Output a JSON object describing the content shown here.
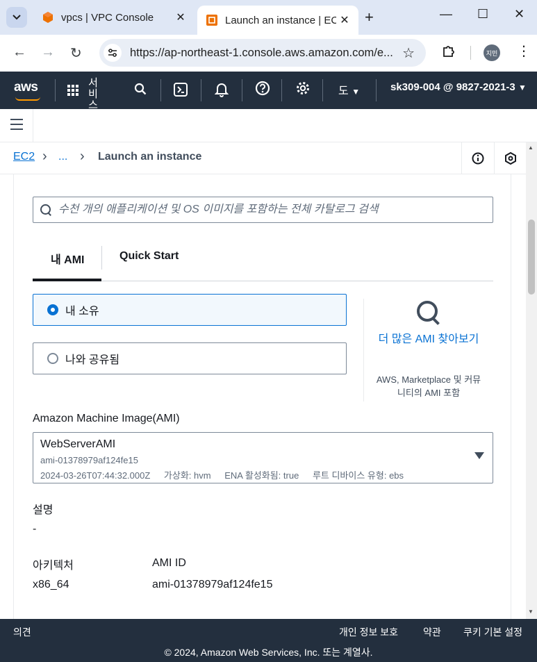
{
  "browser": {
    "tabs": [
      {
        "title": "vpcs | VPC Console",
        "active": false
      },
      {
        "title": "Launch an instance | EC",
        "active": true
      }
    ],
    "new_tab": "+",
    "close_glyph": "✕",
    "url": "https://ap-northeast-1.console.aws.amazon.com/e...",
    "profile_initials": "지민"
  },
  "aws_nav": {
    "logo": "aws",
    "services_label": "서비스",
    "region_label": "도",
    "account": "sk309-004 @ 9827-2021-3"
  },
  "breadcrumb": {
    "root": "EC2",
    "ellipsis": "...",
    "current": "Launch an instance"
  },
  "search": {
    "placeholder": "수천 개의 애플리케이션 및 OS 이미지를 포함하는 전체 카탈로그 검색"
  },
  "tabs": [
    {
      "label": "내 AMI",
      "active": true
    },
    {
      "label": "Quick Start",
      "active": false
    }
  ],
  "ownership": {
    "options": [
      {
        "label": "내 소유",
        "selected": true
      },
      {
        "label": "나와 공유됨",
        "selected": false
      }
    ]
  },
  "browse_more": {
    "link": "더 많은 AMI 찾아보기",
    "description": "AWS, Marketplace 및 커뮤니티의 AMI 포함"
  },
  "ami": {
    "label": "Amazon Machine Image(AMI)",
    "name": "WebServerAMI",
    "id": "ami-01378979af124fe15",
    "date": "2024-03-26T07:44:32.000Z",
    "virtualization": "가상화: hvm",
    "ena": "ENA 활성화됨: true",
    "root_device": "루트 디바이스 유형: ebs"
  },
  "details": {
    "description_label": "설명",
    "description_value": "-",
    "architecture_label": "아키텍처",
    "architecture_value": "x86_64",
    "ami_id_label": "AMI ID",
    "ami_id_value": "ami-01378979af124fe15"
  },
  "footer": {
    "feedback": "의견",
    "privacy": "개인 정보 보호",
    "terms": "약관",
    "cookies": "쿠키 기본 설정",
    "copyright": "© 2024, Amazon Web Services, Inc. 또는 계열사."
  },
  "colors": {
    "aws_nav_bg": "#232f3e",
    "accent_blue": "#0972d3",
    "aws_orange": "#ff9900"
  }
}
